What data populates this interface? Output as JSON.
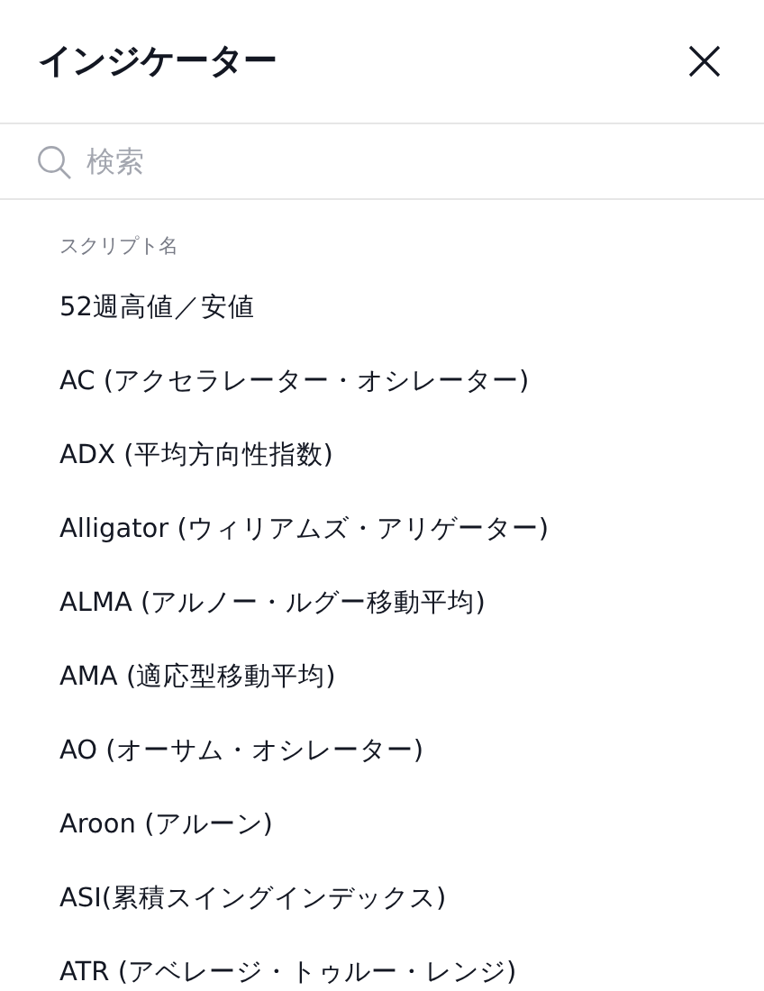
{
  "header": {
    "title": "インジケーター"
  },
  "search": {
    "placeholder": "検索"
  },
  "section": {
    "label": "スクリプト名"
  },
  "items": [
    "52週高値／安値",
    "AC (アクセラレーター・オシレーター)",
    "ADX (平均方向性指数)",
    "Alligator (ウィリアムズ・アリゲーター)",
    "ALMA (アルノー・ルグー移動平均)",
    "AMA (適応型移動平均)",
    "AO (オーサム・オシレーター)",
    "Aroon (アルーン)",
    "ASI(累積スイングインデックス)",
    "ATR (アベレージ・トゥルー・レンジ)"
  ]
}
